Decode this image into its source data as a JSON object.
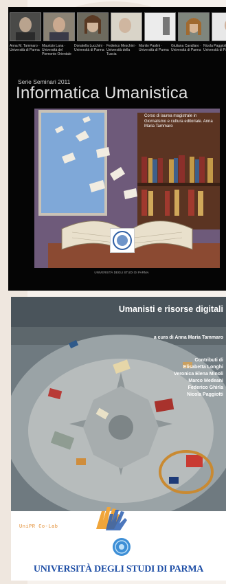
{
  "cover1": {
    "series": "Serie Seminari 2011",
    "title": "Informatica Umanistica",
    "speakers": [
      {
        "caption": "Anna M. Tammaro · Università di Parma"
      },
      {
        "caption": "Maurizio Lana · Università del Piemonte Orientale"
      },
      {
        "caption": "Donatella Lucchini · Università di Parma"
      },
      {
        "caption": "Federico Meschini · Università della Tuscia"
      },
      {
        "caption": "Manlio Paolini · Università di Parma"
      },
      {
        "caption": "Giuliana Cavallaro · Università di Parma"
      },
      {
        "caption": "Nicola Paggiotti · Università di Parma"
      }
    ],
    "blurb": "Corso di laurea magistrale in Giornalismo e cultura editoriale. Anna Maria Tammaro",
    "seal_caption": "UNIVERSITÀ DEGLI STUDI DI PARMA"
  },
  "cover2": {
    "title": "Umanisti e risorse digitali",
    "subtitle": "a cura di Anna Maria Tammaro",
    "contributors_heading": "Contributi di",
    "contributors": [
      "Elisabetta Longhi",
      "Veronica Elena Minoli",
      "Marco Medeani",
      "Federico Ghirla",
      "Nicola Paggiotti"
    ],
    "colab": "UniPR Co-Lab",
    "university": "UNIVERSITÀ DEGLI STUDI DI PARMA"
  },
  "colors": {
    "univ_blue": "#1f4fa6",
    "colab_orange": "#e18a2c",
    "cover1_bg": "#050505"
  }
}
